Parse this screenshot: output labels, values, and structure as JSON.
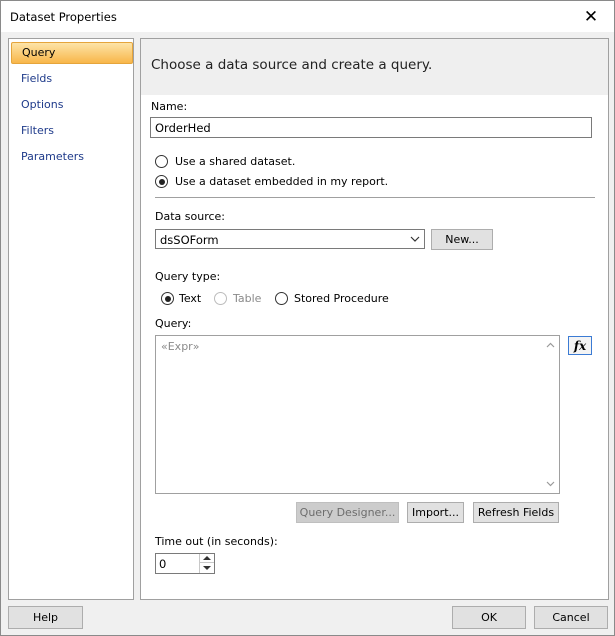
{
  "window": {
    "title": "Dataset Properties",
    "close_glyph": "✕"
  },
  "nav": {
    "items": [
      {
        "label": "Query",
        "selected": true
      },
      {
        "label": "Fields",
        "selected": false
      },
      {
        "label": "Options",
        "selected": false
      },
      {
        "label": "Filters",
        "selected": false
      },
      {
        "label": "Parameters",
        "selected": false
      }
    ]
  },
  "content": {
    "header": "Choose a data source and create a query.",
    "name_label": "Name:",
    "name_value": "OrderHed",
    "dataset_options": [
      {
        "label": "Use a shared dataset.",
        "checked": false
      },
      {
        "label": "Use a dataset embedded in my report.",
        "checked": true
      }
    ],
    "datasource_label": "Data source:",
    "datasource_value": "dsSOForm",
    "new_button": "New...",
    "query_type_label": "Query type:",
    "query_types": [
      {
        "label": "Text",
        "checked": true,
        "disabled": false
      },
      {
        "label": "Table",
        "checked": false,
        "disabled": true
      },
      {
        "label": "Stored Procedure",
        "checked": false,
        "disabled": false
      }
    ],
    "query_label": "Query:",
    "query_placeholder": "«Expr»",
    "fx_label": "fx",
    "query_designer_button": "Query Designer...",
    "import_button": "Import...",
    "refresh_fields_button": "Refresh Fields",
    "timeout_label": "Time out (in seconds):",
    "timeout_value": "0"
  },
  "footer": {
    "help_button": "Help",
    "ok_button": "OK",
    "cancel_button": "Cancel"
  },
  "colors": {
    "accent_border": "#3b7bd4",
    "nav_link": "#1e3a8a",
    "selected_nav": "#f8b64a"
  }
}
